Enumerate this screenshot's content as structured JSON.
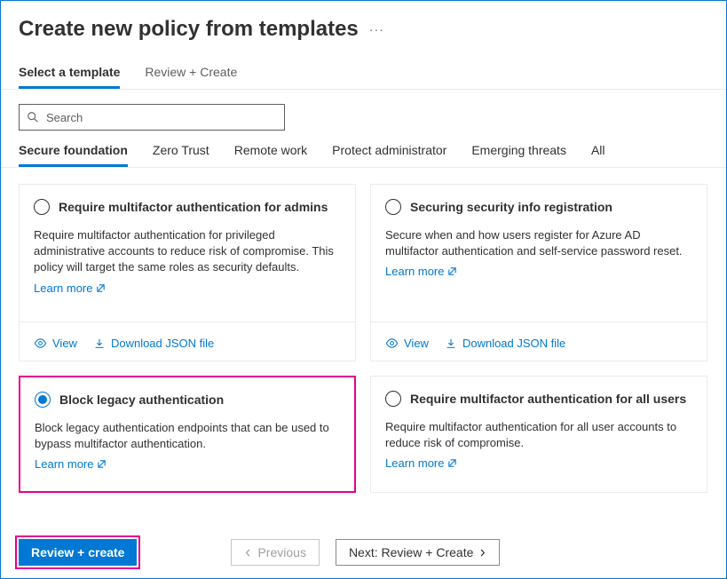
{
  "header": {
    "title": "Create new policy from templates"
  },
  "steps": [
    {
      "label": "Select a template",
      "active": true
    },
    {
      "label": "Review + Create",
      "active": false
    }
  ],
  "search": {
    "placeholder": "Search"
  },
  "tabs": [
    {
      "label": "Secure foundation",
      "active": true
    },
    {
      "label": "Zero Trust",
      "active": false
    },
    {
      "label": "Remote work",
      "active": false
    },
    {
      "label": "Protect administrator",
      "active": false
    },
    {
      "label": "Emerging threats",
      "active": false
    },
    {
      "label": "All",
      "active": false
    }
  ],
  "cards": [
    {
      "title": "Require multifactor authentication for admins",
      "desc": "Require multifactor authentication for privileged administrative accounts to reduce risk of compromise. This policy will target the same roles as security defaults.",
      "learn": "Learn more",
      "view": "View",
      "download": "Download JSON file",
      "selected": false,
      "showActions": true
    },
    {
      "title": "Securing security info registration",
      "desc": "Secure when and how users register for Azure AD multifactor authentication and self-service password reset.",
      "learn": "Learn more",
      "view": "View",
      "download": "Download JSON file",
      "selected": false,
      "showActions": true
    },
    {
      "title": "Block legacy authentication",
      "desc": "Block legacy authentication endpoints that can be used to bypass multifactor authentication.",
      "learn": "Learn more",
      "selected": true,
      "showActions": false,
      "highlight": true
    },
    {
      "title": "Require multifactor authentication for all users",
      "desc": "Require multifactor authentication for all user accounts to reduce risk of compromise.",
      "learn": "Learn more",
      "selected": false,
      "showActions": false
    }
  ],
  "footer": {
    "review": "Review + create",
    "previous": "Previous",
    "next": "Next: Review + Create"
  },
  "colors": {
    "accent": "#0078d4",
    "highlight": "#e3008c"
  }
}
